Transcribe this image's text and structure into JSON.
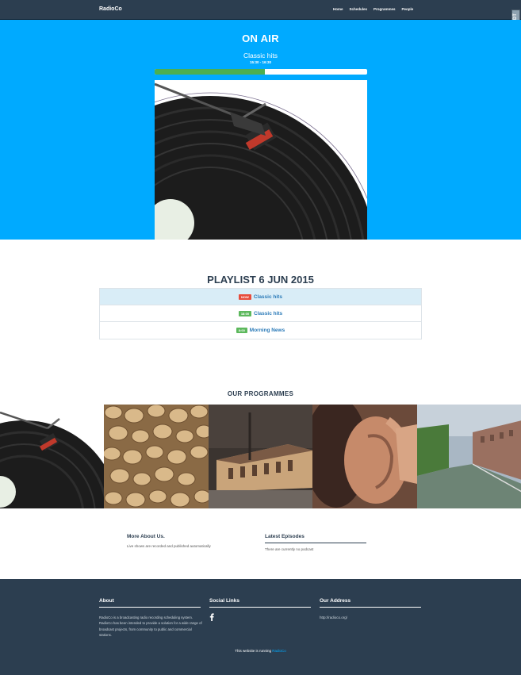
{
  "navbar": {
    "brand": "RadioCo",
    "items": [
      "Home",
      "Schedules",
      "Programmes",
      "People"
    ],
    "debug_toolbar": "DjDT"
  },
  "on_air": {
    "title": "ON AIR",
    "show": "Classic hits",
    "time": "15:30 - 16:30",
    "progress": 0.52
  },
  "playlist": {
    "title": "PLAYLIST 6 JUN 2015",
    "rows": [
      {
        "badge": "NOW",
        "badge_color": "#e74c3c",
        "name": "Classic hits",
        "active": true
      },
      {
        "badge": "18:00",
        "badge_color": "#5cb85c",
        "name": "Classic hits",
        "active": false
      },
      {
        "badge": "8:00",
        "badge_color": "#5cb85c",
        "name": "Morning News",
        "active": false
      }
    ]
  },
  "programmes": {
    "title": "OUR PROGRAMMES",
    "images": [
      "vinyl-record",
      "wine-corks",
      "train-station",
      "ear",
      "canal-town"
    ]
  },
  "more": {
    "title": "More About Us.",
    "text": "Live shows are recorded and published automatically"
  },
  "episodes": {
    "title": "Latest Episodes",
    "text": "There are currently no podcast"
  },
  "footer": {
    "about_title": "About",
    "about_text": "RadioCo is a broadcasting radio recording scheduling system. RadioCo has been intended to provide a solution for a wide range of broadcast projects, from community to public and commercial stations.",
    "social_title": "Social Links",
    "address_title": "Our Address",
    "address": "http://radioco.org/",
    "running_prefix": "This website is running",
    "running_link": "RadioCo"
  },
  "colors": {
    "navbar": "#2c3e50",
    "hero": "#00aaff",
    "progress": "#4caf50",
    "link": "#2a7ab8"
  }
}
